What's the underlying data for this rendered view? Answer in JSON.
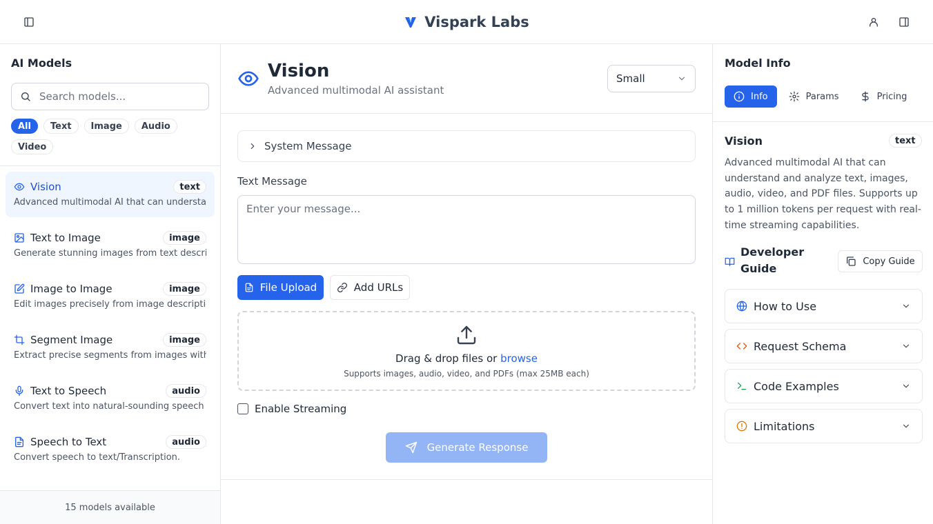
{
  "app": {
    "brand": "Vispark Labs"
  },
  "sidebar": {
    "title": "AI Models",
    "search_placeholder": "Search models...",
    "filters": [
      "All",
      "Text",
      "Image",
      "Audio",
      "Video"
    ],
    "active_filter": "All",
    "models": [
      {
        "name": "Vision",
        "badge": "text",
        "desc": "Advanced multimodal AI that can understand and analyze text",
        "icon": "eye-icon",
        "selected": true
      },
      {
        "name": "Text to Image",
        "badge": "image",
        "desc": "Generate stunning images from text descriptions",
        "icon": "image-icon",
        "selected": false
      },
      {
        "name": "Image to Image",
        "badge": "image",
        "desc": "Edit images precisely from image description and",
        "icon": "edit-icon",
        "selected": false
      },
      {
        "name": "Segment Image",
        "badge": "image",
        "desc": "Extract precise segments from images with points",
        "icon": "crop-icon",
        "selected": false
      },
      {
        "name": "Text to Speech",
        "badge": "audio",
        "desc": "Convert text into natural-sounding speech with",
        "icon": "microphone-icon",
        "selected": false
      },
      {
        "name": "Speech to Text",
        "badge": "audio",
        "desc": "Convert speech to text/Transcription.",
        "icon": "file-text-icon",
        "selected": false
      }
    ],
    "footer": "15 models available"
  },
  "main": {
    "title": "Vision",
    "subtitle": "Advanced multimodal AI assistant",
    "size": "Small",
    "system_message_label": "System Message",
    "text_message_label": "Text Message",
    "text_message_placeholder": "Enter your message...",
    "file_upload_label": "File Upload",
    "add_urls_label": "Add URLs",
    "dropzone_text": "Drag & drop files or",
    "dropzone_link": "browse",
    "dropzone_hint": "Supports images, audio, video, and PDFs (max 25MB each)",
    "streaming_label": "Enable Streaming",
    "generate_label": "Generate Response"
  },
  "info_panel": {
    "title": "Model Info",
    "tabs": [
      "Info",
      "Params",
      "Pricing"
    ],
    "active_tab": "Info",
    "model_name": "Vision",
    "model_badge": "text",
    "description": "Advanced multimodal AI that can understand and analyze text, images, audio, video, and PDF files. Supports up to 1 million tokens per request with real-time streaming capabilities.",
    "dev_guide_title": "Developer Guide",
    "copy_guide_label": "Copy Guide",
    "sections": [
      {
        "label": "How to Use",
        "icon": "globe-icon",
        "color": "#2563eb"
      },
      {
        "label": "Request Schema",
        "icon": "code-icon",
        "color": "#ea580c"
      },
      {
        "label": "Code Examples",
        "icon": "terminal-icon",
        "color": "#16a34a"
      },
      {
        "label": "Limitations",
        "icon": "alert-circle-icon",
        "color": "#d97706"
      }
    ]
  }
}
